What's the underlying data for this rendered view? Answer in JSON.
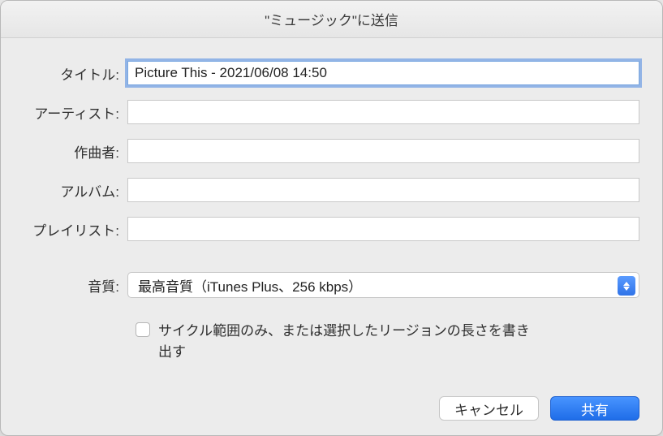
{
  "dialog": {
    "title": "\"ミュージック\"に送信"
  },
  "form": {
    "title_label": "タイトル:",
    "title_value": "Picture This - 2021/06/08 14:50",
    "artist_label": "アーティスト:",
    "artist_value": "",
    "composer_label": "作曲者:",
    "composer_value": "",
    "album_label": "アルバム:",
    "album_value": "",
    "playlist_label": "プレイリスト:",
    "playlist_value": "",
    "quality_label": "音質:",
    "quality_value": "最高音質（iTunes Plus、256 kbps）",
    "cycle_checkbox_label": "サイクル範囲のみ、または選択したリージョンの長さを書き出す",
    "cycle_checked": false
  },
  "buttons": {
    "cancel": "キャンセル",
    "share": "共有"
  }
}
